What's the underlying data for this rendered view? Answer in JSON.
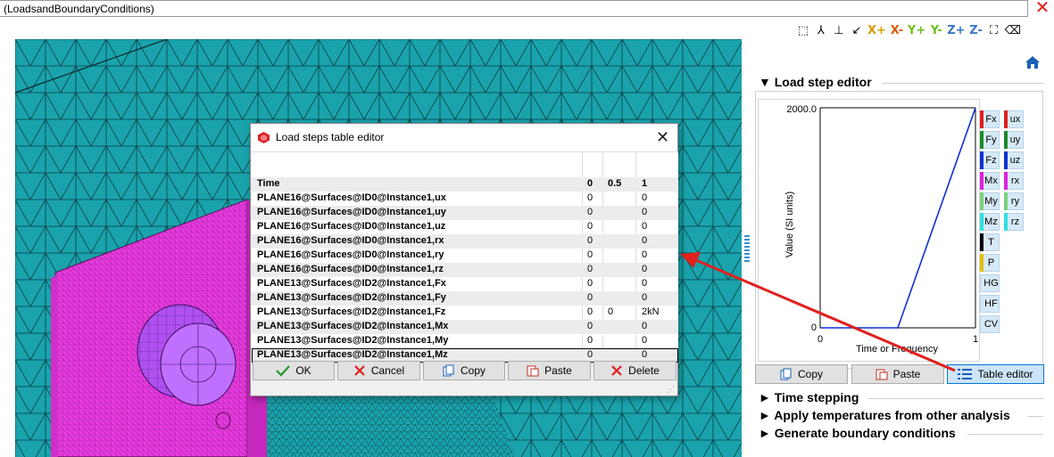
{
  "window": {
    "title": "(LoadsandBoundaryConditions)",
    "close_glyph": "✕"
  },
  "toolbar": {
    "items": [
      {
        "icon": "select-box-icon",
        "glyph": "⬚"
      },
      {
        "icon": "axes-icon",
        "glyph": "⅄"
      },
      {
        "icon": "axes-flat-icon",
        "glyph": "⊥"
      },
      {
        "icon": "axes-iso-icon",
        "glyph": "↙"
      },
      {
        "label": "X+"
      },
      {
        "label": "X-"
      },
      {
        "label": "Y+"
      },
      {
        "label": "Y-"
      },
      {
        "label": "Z+"
      },
      {
        "label": "Z-"
      },
      {
        "icon": "fit-view-icon",
        "glyph": "⛶"
      },
      {
        "icon": "eraser-icon",
        "glyph": "⌫"
      }
    ]
  },
  "dialog": {
    "title": "Load steps table editor",
    "close_glyph": "✕",
    "header": {
      "label": "Time",
      "v0": "0",
      "v1": "0.5",
      "v2": "1"
    },
    "rows": [
      {
        "label": "PLANE16@Surfaces@ID0@Instance1,ux",
        "v0": "0",
        "v1": "",
        "v2": "0"
      },
      {
        "label": "PLANE16@Surfaces@ID0@Instance1,uy",
        "v0": "0",
        "v1": "",
        "v2": "0"
      },
      {
        "label": "PLANE16@Surfaces@ID0@Instance1,uz",
        "v0": "0",
        "v1": "",
        "v2": "0"
      },
      {
        "label": "PLANE16@Surfaces@ID0@Instance1,rx",
        "v0": "0",
        "v1": "",
        "v2": "0"
      },
      {
        "label": "PLANE16@Surfaces@ID0@Instance1,ry",
        "v0": "0",
        "v1": "",
        "v2": "0"
      },
      {
        "label": "PLANE16@Surfaces@ID0@Instance1,rz",
        "v0": "0",
        "v1": "",
        "v2": "0"
      },
      {
        "label": "PLANE13@Surfaces@ID2@Instance1,Fx",
        "v0": "0",
        "v1": "",
        "v2": "0"
      },
      {
        "label": "PLANE13@Surfaces@ID2@Instance1,Fy",
        "v0": "0",
        "v1": "",
        "v2": "0"
      },
      {
        "label": "PLANE13@Surfaces@ID2@Instance1,Fz",
        "v0": "0",
        "v1": "0",
        "v2": "2kN"
      },
      {
        "label": "PLANE13@Surfaces@ID2@Instance1,Mx",
        "v0": "0",
        "v1": "",
        "v2": "0"
      },
      {
        "label": "PLANE13@Surfaces@ID2@Instance1,My",
        "v0": "0",
        "v1": "",
        "v2": "0"
      },
      {
        "label": "PLANE13@Surfaces@ID2@Instance1,Mz",
        "v0": "0",
        "v1": "",
        "v2": "0"
      }
    ],
    "buttons": {
      "ok": "OK",
      "cancel": "Cancel",
      "copy": "Copy",
      "paste": "Paste",
      "delete": "Delete"
    }
  },
  "right_panel": {
    "load_step_editor": "Load step editor",
    "plot": {
      "ymax_label": "2000.0",
      "ymin_label": "0",
      "xmin_label": "0",
      "xmax_label": "1",
      "ylabel": "Value (SI units)",
      "xlabel": "Time or Frequency"
    },
    "legend_buttons_left": [
      {
        "label": "Fx",
        "color": "#e0201c"
      },
      {
        "label": "Fy",
        "color": "#1b8a2a"
      },
      {
        "label": "Fz",
        "color": "#1030d0"
      },
      {
        "label": "Mx",
        "color": "#e020e0"
      },
      {
        "label": "My",
        "color": "#7cd07c"
      },
      {
        "label": "Mz",
        "color": "#30e0e0"
      },
      {
        "label": "T",
        "color": "#000000"
      },
      {
        "label": "P",
        "color": "#e0c000"
      },
      {
        "label": "HG",
        "color": ""
      },
      {
        "label": "HF",
        "color": ""
      },
      {
        "label": "CV",
        "color": ""
      }
    ],
    "legend_buttons_right": [
      {
        "label": "ux",
        "color": "#e0201c"
      },
      {
        "label": "uy",
        "color": "#1b8a2a"
      },
      {
        "label": "uz",
        "color": "#1030d0"
      },
      {
        "label": "rx",
        "color": "#e020e0"
      },
      {
        "label": "ry",
        "color": "#7cd07c"
      },
      {
        "label": "rz",
        "color": "#30e0e0"
      }
    ],
    "buttons": {
      "copy": "Copy",
      "paste": "Paste",
      "table_editor": "Table editor"
    },
    "sections": [
      "Time stepping",
      "Apply temperatures from other analysis",
      "Generate boundary conditions"
    ]
  },
  "chart_data": {
    "type": "line",
    "xlabel": "Time or Frequency",
    "ylabel": "Value (SI units)",
    "xlim": [
      0,
      1
    ],
    "ylim": [
      0,
      2000
    ],
    "series": [
      {
        "color": "#1030d0",
        "x": [
          0,
          0.5,
          1
        ],
        "y": [
          0,
          0,
          2000
        ]
      }
    ]
  },
  "colors": {
    "mesh_background": "#1aa3ac",
    "part_magenta": "#e83ae0",
    "annotation_arrow": "#e0201c"
  }
}
